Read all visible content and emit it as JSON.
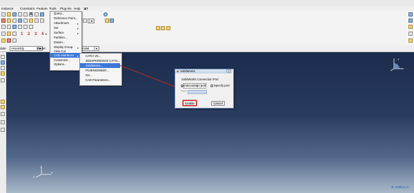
{
  "menubar": {
    "items": [
      "Instance",
      "Constraint",
      "Feature",
      "Tools",
      "Plug-ins",
      "Help"
    ]
  },
  "toolbar": {
    "step_numbers": [
      "1",
      "2",
      "3",
      "4"
    ]
  },
  "context_bar": {
    "module_label": "dule",
    "module_value": "Assembly",
    "model_label": "Model",
    "step_value": "Initial"
  },
  "tools_menu": {
    "items": [
      {
        "label": "Query...",
        "submenu": false
      },
      {
        "label": "Reference Point...",
        "submenu": false
      },
      {
        "label": "Attachment",
        "submenu": true
      },
      {
        "label": "Set",
        "submenu": true
      },
      {
        "label": "Surface",
        "submenu": true
      },
      {
        "label": "Partition...",
        "submenu": false
      },
      {
        "label": "Datum...",
        "submenu": false
      },
      {
        "label": "Display Group",
        "submenu": true
      },
      {
        "label": "View Cut",
        "submenu": false
      },
      {
        "label": "CAD Interfaces",
        "submenu": true,
        "highlighted": true
      },
      {
        "label": "Customize...",
        "submenu": false
      },
      {
        "label": "Options...",
        "submenu": false
      }
    ]
  },
  "cad_submenu": {
    "items": [
      {
        "label": "CATIA V5..."
      },
      {
        "label": "3DEXPERIENCE CATIA..."
      },
      {
        "label": "SolidWorks...",
        "highlighted": true
      },
      {
        "label": "Pro/ENGINEER..."
      },
      {
        "label": "NX..."
      },
      {
        "label": "CAD Parameters..."
      }
    ]
  },
  "dialog": {
    "title": "SolidWorks",
    "heading": "SolidWorks Connection Port",
    "option_auto": "Auto-assign port",
    "option_specify": "Specify port",
    "port_label": "Port:",
    "port_value": "",
    "enable_label": "Enable",
    "cancel_label": "Cancel",
    "selected_option": "auto"
  },
  "colors": {
    "annotation_red": "#c0282a",
    "menu_highlight": "#3b78d8",
    "viewport_top": "#1b2b4c",
    "viewport_bottom": "#a9b9ca"
  }
}
